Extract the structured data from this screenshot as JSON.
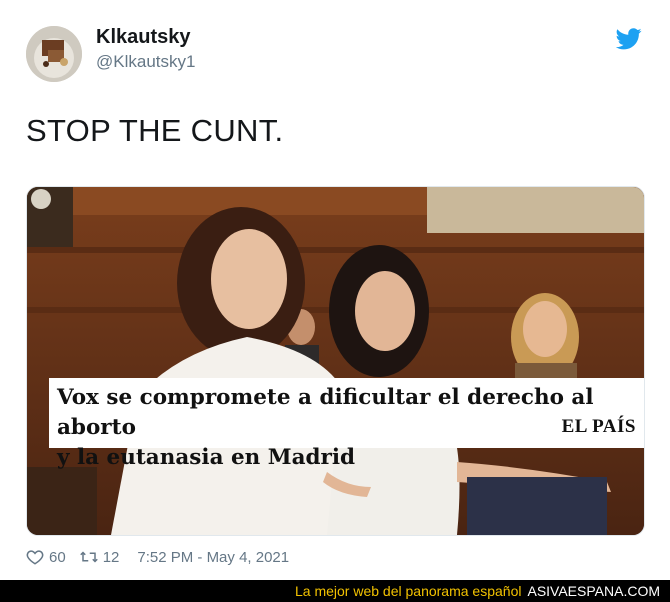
{
  "author": {
    "name": "Klkautsky",
    "handle": "@Klkautsky1"
  },
  "tweet": {
    "text": "STOP THE CUNT.",
    "likes": "60",
    "retweets": "12",
    "timestamp": "7:52 PM - May 4, 2021"
  },
  "media": {
    "headline_line1": "Vox se compromete a dificultar el derecho al aborto",
    "headline_line2": "y la eutanasia en Madrid",
    "brand": "EL PAÍS"
  },
  "banner": {
    "tagline": "La mejor web del panorama español",
    "site": "ASIVAESPANA.COM"
  },
  "colors": {
    "twitter_blue": "#1da1f2",
    "secondary_text": "#657786",
    "banner_accent": "#f2c200"
  },
  "icons": [
    "twitter-bird-icon",
    "heart-icon",
    "retweet-icon"
  ]
}
